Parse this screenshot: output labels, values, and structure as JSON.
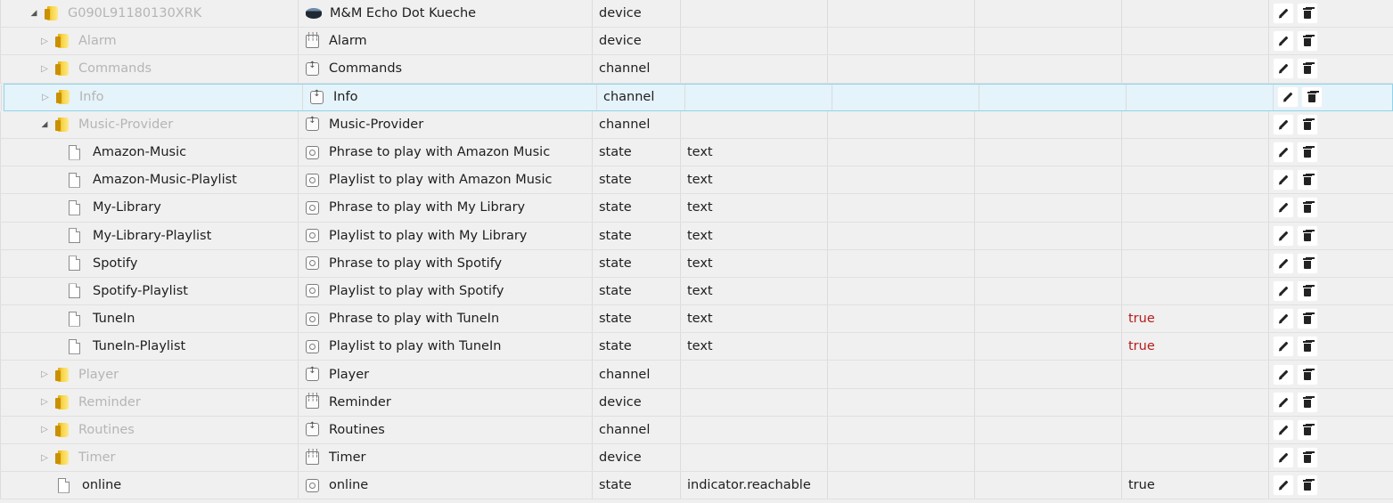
{
  "colors": {
    "value_red": "#b71c1c",
    "selected_bg": "#e5f3fa",
    "selected_border": "#8fd3ec"
  },
  "rows": [
    {
      "id": "G090L91180130XRK",
      "name": "M&M Echo Dot Kueche",
      "type": "device",
      "role": "",
      "value": "",
      "level": 0,
      "kind": "folder",
      "expand": "open",
      "icon": "echo-device-icon",
      "muted": true
    },
    {
      "id": "Alarm",
      "name": "Alarm",
      "type": "device",
      "role": "",
      "value": "",
      "level": 1,
      "kind": "folder",
      "expand": "closed",
      "icon": "device-icon",
      "muted": true
    },
    {
      "id": "Commands",
      "name": "Commands",
      "type": "channel",
      "role": "",
      "value": "",
      "level": 1,
      "kind": "folder",
      "expand": "closed",
      "icon": "channel-icon",
      "muted": true
    },
    {
      "id": "Info",
      "name": "Info",
      "type": "channel",
      "role": "",
      "value": "",
      "level": 1,
      "kind": "folder",
      "expand": "closed",
      "icon": "channel-icon",
      "muted": true,
      "selected": true
    },
    {
      "id": "Music-Provider",
      "name": "Music-Provider",
      "type": "channel",
      "role": "",
      "value": "",
      "level": 1,
      "kind": "folder",
      "expand": "open",
      "icon": "channel-icon",
      "muted": true
    },
    {
      "id": "Amazon-Music",
      "name": "Phrase to play with Amazon Music",
      "type": "state",
      "role": "text",
      "value": "",
      "level": 2,
      "kind": "file",
      "icon": "state-icon"
    },
    {
      "id": "Amazon-Music-Playlist",
      "name": "Playlist to play with Amazon Music",
      "type": "state",
      "role": "text",
      "value": "",
      "level": 2,
      "kind": "file",
      "icon": "state-icon"
    },
    {
      "id": "My-Library",
      "name": "Phrase to play with My Library",
      "type": "state",
      "role": "text",
      "value": "",
      "level": 2,
      "kind": "file",
      "icon": "state-icon"
    },
    {
      "id": "My-Library-Playlist",
      "name": "Playlist to play with My Library",
      "type": "state",
      "role": "text",
      "value": "",
      "level": 2,
      "kind": "file",
      "icon": "state-icon"
    },
    {
      "id": "Spotify",
      "name": "Phrase to play with Spotify",
      "type": "state",
      "role": "text",
      "value": "",
      "level": 2,
      "kind": "file",
      "icon": "state-icon"
    },
    {
      "id": "Spotify-Playlist",
      "name": "Playlist to play with Spotify",
      "type": "state",
      "role": "text",
      "value": "",
      "level": 2,
      "kind": "file",
      "icon": "state-icon"
    },
    {
      "id": "TuneIn",
      "name": "Phrase to play with TuneIn",
      "type": "state",
      "role": "text",
      "value": "true",
      "value_style": "red",
      "level": 2,
      "kind": "file",
      "icon": "state-icon"
    },
    {
      "id": "TuneIn-Playlist",
      "name": "Playlist to play with TuneIn",
      "type": "state",
      "role": "text",
      "value": "true",
      "value_style": "red",
      "level": 2,
      "kind": "file",
      "icon": "state-icon"
    },
    {
      "id": "Player",
      "name": "Player",
      "type": "channel",
      "role": "",
      "value": "",
      "level": 1,
      "kind": "folder",
      "expand": "closed",
      "icon": "channel-icon",
      "muted": true
    },
    {
      "id": "Reminder",
      "name": "Reminder",
      "type": "device",
      "role": "",
      "value": "",
      "level": 1,
      "kind": "folder",
      "expand": "closed",
      "icon": "device-icon",
      "muted": true
    },
    {
      "id": "Routines",
      "name": "Routines",
      "type": "channel",
      "role": "",
      "value": "",
      "level": 1,
      "kind": "folder",
      "expand": "closed",
      "icon": "channel-icon",
      "muted": true
    },
    {
      "id": "Timer",
      "name": "Timer",
      "type": "device",
      "role": "",
      "value": "",
      "level": 1,
      "kind": "folder",
      "expand": "closed",
      "icon": "device-icon",
      "muted": true
    },
    {
      "id": "online",
      "name": "online",
      "type": "state",
      "role": "indicator.reachable",
      "value": "true",
      "value_style": "dark",
      "level": 1,
      "kind": "file",
      "icon": "state-icon"
    }
  ]
}
